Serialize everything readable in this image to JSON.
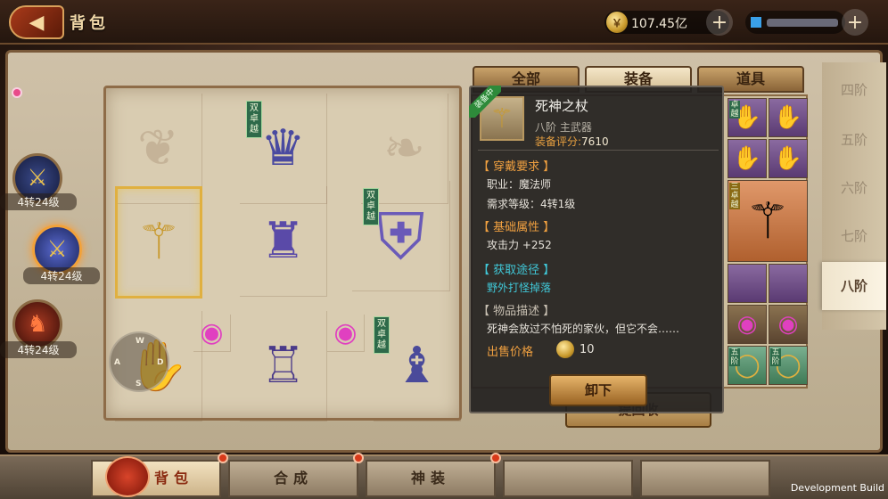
{
  "header": {
    "back_glyph": "◀",
    "title": "背包",
    "gold": "107.45亿",
    "add": "+"
  },
  "heroes": [
    {
      "level": "4转24级"
    },
    {
      "level": "4转24级"
    },
    {
      "level": "4转24级"
    }
  ],
  "equip_tags": {
    "tag1": "双卓越",
    "tag2": "双卓越",
    "tag3": "双卓越"
  },
  "joystick": {
    "w": "W",
    "a": "A",
    "s": "S",
    "d": "D"
  },
  "tabs": [
    "全部",
    "装备",
    "道具"
  ],
  "tiers": [
    "四阶",
    "五阶",
    "六阶",
    "七阶",
    "八阶"
  ],
  "grid_tags": {
    "excellent": "卓越",
    "five": "五阶",
    "triple": "三卓越"
  },
  "tooltip": {
    "equipped_badge": "装备中",
    "name": "死神之杖",
    "type": "八阶 主武器",
    "score_label": "装备评分:",
    "score": "7610",
    "req_title": "【 穿戴要求 】",
    "req_job": "职业：魔法师",
    "req_level": "需求等级：4转1级",
    "attr_title": "【 基础属性 】",
    "attr_atk": "攻击力 +252",
    "source_title": "【 获取途径 】",
    "source": "野外打怪掉落",
    "desc_title": "【 物品描述 】",
    "desc": "死神会放过不怕死的家伙，但它不会……",
    "sell_label": "出售价格",
    "sell_price": "10",
    "unequip": "卸下"
  },
  "behind_button": "提回收",
  "bottom_nav": [
    "背包",
    "合成",
    "神装",
    "",
    ""
  ],
  "dev_label": "Development Build",
  "colors": {
    "accent_gold": "#e8a040",
    "cyan": "#40c8d8",
    "tier_active": "#fbf4e4"
  }
}
